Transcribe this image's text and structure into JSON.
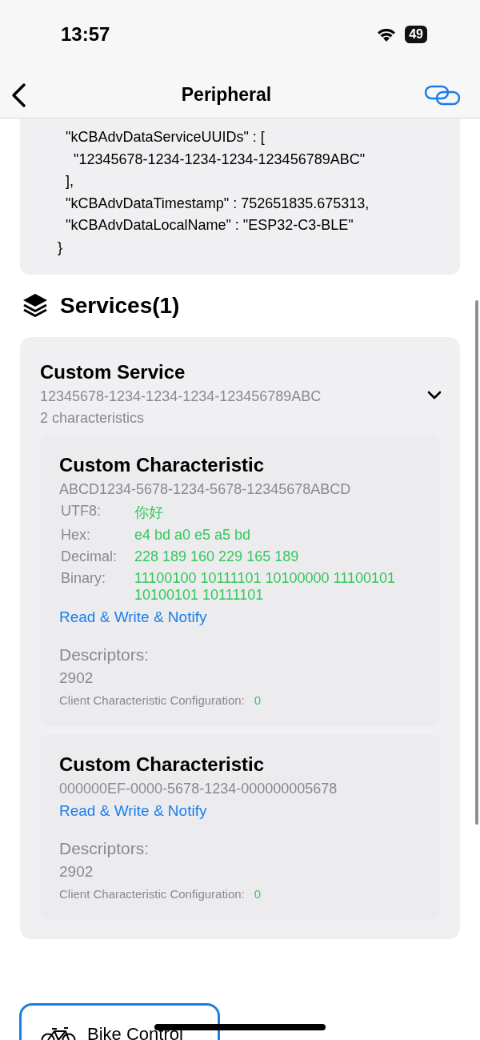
{
  "status_bar": {
    "time": "13:57",
    "battery": "49"
  },
  "nav": {
    "title": "Peripheral"
  },
  "advertisement": {
    "lines": [
      "  \"kCBAdvDataServiceUUIDs\" : [",
      "    \"12345678-1234-1234-1234-123456789ABC\"",
      "  ],",
      "  \"kCBAdvDataTimestamp\" : 752651835.675313,",
      "  \"kCBAdvDataLocalName\" : \"ESP32-C3-BLE\"",
      "}"
    ]
  },
  "services_heading": "Services(1)",
  "services": [
    {
      "name": "Custom Service",
      "uuid": "12345678-1234-1234-1234-123456789ABC",
      "count": "2 characteristics",
      "expanded": true,
      "characteristics": [
        {
          "name": "Custom Characteristic",
          "uuid": "ABCD1234-5678-1234-5678-12345678ABCD",
          "values": [
            {
              "label": "UTF8:",
              "value": "你好"
            },
            {
              "label": "Hex:",
              "value": "e4 bd a0 e5 a5 bd"
            },
            {
              "label": "Decimal:",
              "value": "228 189 160 229 165 189"
            },
            {
              "label": "Binary:",
              "value": "11100100 10111101 10100000 11100101 10100101 10111101"
            }
          ],
          "properties": "Read & Write & Notify",
          "descriptors_label": "Descriptors:",
          "descriptors": [
            {
              "uuid": "2902",
              "name": "Client Characteristic Configuration:",
              "value": "0"
            }
          ]
        },
        {
          "name": "Custom Characteristic",
          "uuid": "000000EF-0000-5678-1234-000000005678",
          "properties": "Read & Write & Notify",
          "descriptors_label": "Descriptors:",
          "descriptors": [
            {
              "uuid": "2902",
              "name": "Client Characteristic Configuration:",
              "value": "0"
            }
          ]
        }
      ]
    }
  ],
  "bottom_button": {
    "label": "Bike Control"
  }
}
